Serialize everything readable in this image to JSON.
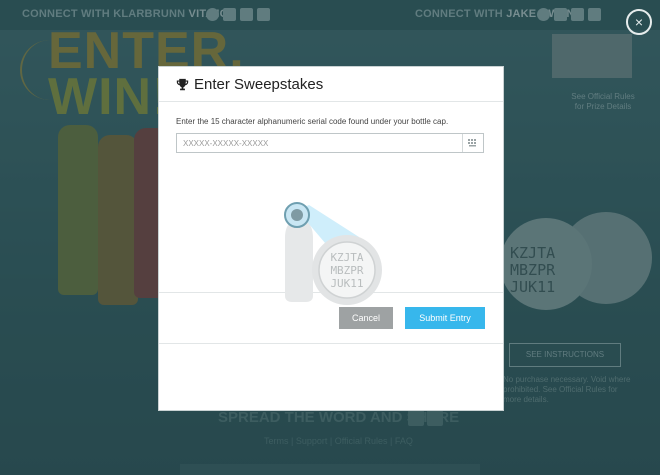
{
  "background": {
    "connect_left_prefix": "CONNECT WITH KLARBRUNN ",
    "connect_left_brand": "VITA ICE",
    "connect_right_prefix": "CONNECT WITH ",
    "connect_right_brand": "JAKE OWEN",
    "headline_line1": "ENTER.",
    "headline_line2": "WIN!",
    "cap_code_lines": [
      "KZJTA",
      "MBZPR",
      "JUK11"
    ],
    "prize_link": "See Official Rules for Prize Details",
    "see_instructions": "SEE INSTRUCTIONS",
    "fine_print": "No purchase necessary. Void where prohibited. See Official Rules for more details.",
    "spread_word": "SPREAD THE WORD AND SHARE",
    "footer_links": "Terms | Support | Official Rules | FAQ"
  },
  "overlay": {
    "close_icon": "×"
  },
  "modal": {
    "title": "Enter Sweepstakes",
    "title_icon": "trophy-icon",
    "instructions": "Enter the 15 character alphanumeric serial code found under your bottle cap.",
    "code_placeholder": "XXXXX-XXXXX-XXXXX",
    "code_value": "",
    "field_icon": "keyboard-icon",
    "cap_code_lines": [
      "KZJTA",
      "MBZPR",
      "JUK11"
    ],
    "cancel_label": "Cancel",
    "submit_label": "Submit Entry"
  },
  "colors": {
    "accent": "#37b7ec",
    "cancel": "#9ea2a3",
    "background_teal": "#2f5f66"
  }
}
